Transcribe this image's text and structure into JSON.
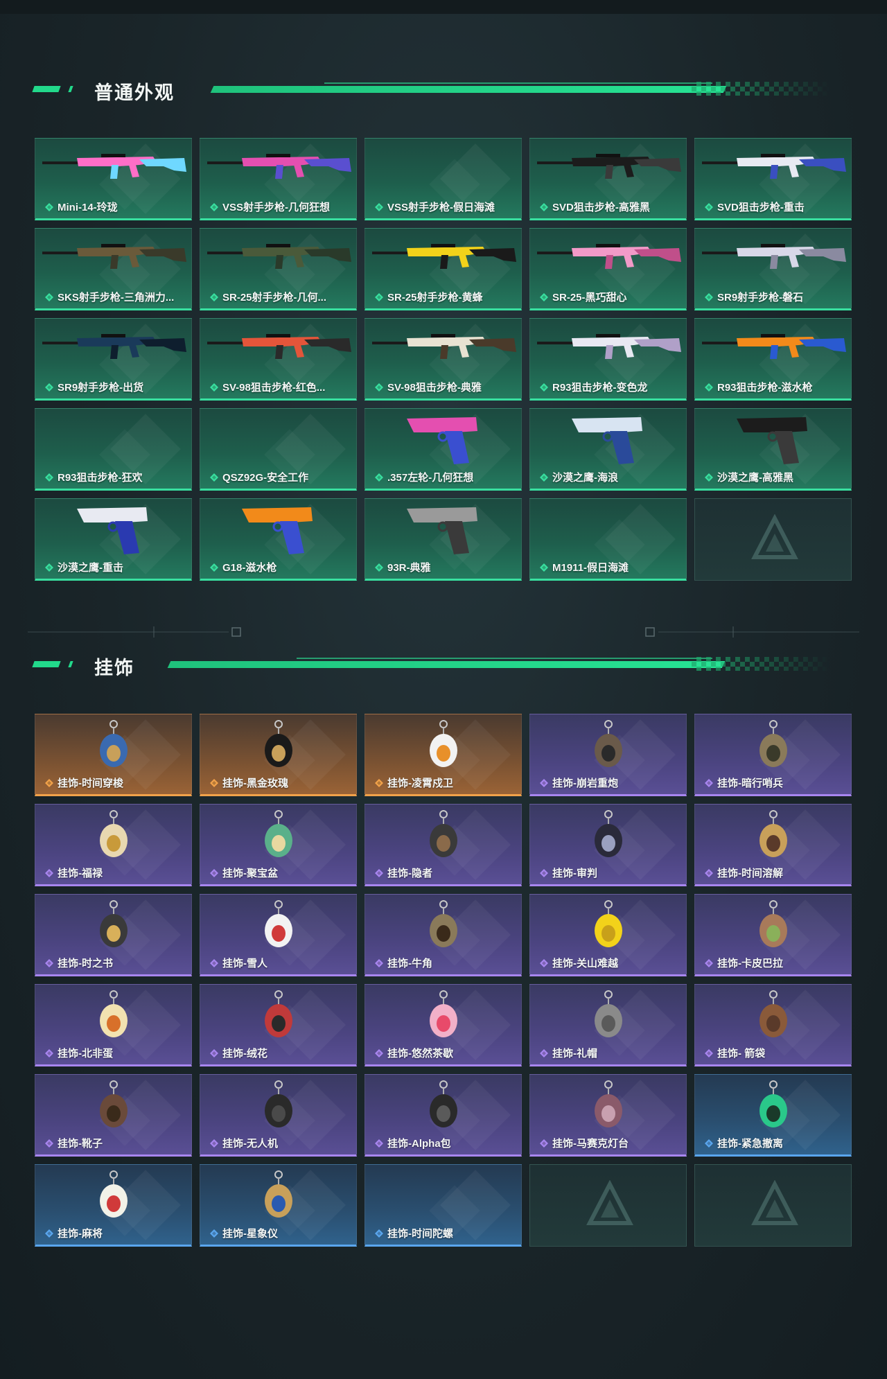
{
  "sections": [
    {
      "title": "普通外观",
      "theme_color": "#22d98b",
      "items": [
        {
          "label": "Mini-14-玲珑",
          "rarity": "green",
          "art": "rifle",
          "colors": [
            "#ff6ec7",
            "#6fd8ff"
          ]
        },
        {
          "label": "VSS射手步枪-几何狂想",
          "rarity": "green",
          "art": "rifle",
          "colors": [
            "#e44fb0",
            "#5a4fd0"
          ]
        },
        {
          "label": "VSS射手步枪-假日海滩",
          "rarity": "green",
          "art": "none",
          "colors": []
        },
        {
          "label": "SVD狙击步枪-高雅黑",
          "rarity": "green",
          "art": "rifle",
          "colors": [
            "#1c1c1c",
            "#3a3a3a"
          ]
        },
        {
          "label": "SVD狙击步枪-重击",
          "rarity": "green",
          "art": "rifle",
          "colors": [
            "#e8eaf2",
            "#3a4fc0"
          ]
        },
        {
          "label": "SKS射手步枪-三角洲力...",
          "rarity": "green",
          "art": "rifle",
          "colors": [
            "#6a5a3a",
            "#3a3a2a"
          ]
        },
        {
          "label": "SR-25射手步枪-几何...",
          "rarity": "green",
          "art": "rifle",
          "colors": [
            "#4a5a3a",
            "#2a3a2a"
          ]
        },
        {
          "label": "SR-25射手步枪-黄蜂",
          "rarity": "green",
          "art": "rifle",
          "colors": [
            "#f2d21a",
            "#1a1a1a"
          ]
        },
        {
          "label": "SR-25-黑巧甜心",
          "rarity": "green",
          "art": "rifle",
          "colors": [
            "#f29ac8",
            "#c04f8a"
          ]
        },
        {
          "label": "SR9射手步枪-磐石",
          "rarity": "green",
          "art": "rifle",
          "colors": [
            "#d8d8e8",
            "#8a8aa0"
          ]
        },
        {
          "label": "SR9射手步枪-出货",
          "rarity": "green",
          "art": "rifle",
          "colors": [
            "#1a3a5a",
            "#0e1e2e"
          ]
        },
        {
          "label": "SV-98狙击步枪-红色...",
          "rarity": "green",
          "art": "rifle",
          "colors": [
            "#e4553a",
            "#2a2a2a"
          ]
        },
        {
          "label": "SV-98狙击步枪-典雅",
          "rarity": "green",
          "art": "rifle",
          "colors": [
            "#e8e2d2",
            "#4a3a2a"
          ]
        },
        {
          "label": "R93狙击步枪-变色龙",
          "rarity": "green",
          "art": "rifle",
          "colors": [
            "#e8e8f2",
            "#b0a0c8"
          ]
        },
        {
          "label": "R93狙击步枪-滋水枪",
          "rarity": "green",
          "art": "rifle",
          "colors": [
            "#f28a1a",
            "#2a5ad0"
          ]
        },
        {
          "label": "R93狙击步枪-狂欢",
          "rarity": "green",
          "art": "none",
          "colors": []
        },
        {
          "label": "QSZ92G-安全工作",
          "rarity": "green",
          "art": "none",
          "colors": []
        },
        {
          "label": ".357左轮-几何狂想",
          "rarity": "green",
          "art": "pistol",
          "colors": [
            "#e44fb0",
            "#3a4fd0"
          ]
        },
        {
          "label": "沙漠之鹰-海浪",
          "rarity": "green",
          "art": "pistol",
          "colors": [
            "#d8e4f2",
            "#2a4a9a"
          ]
        },
        {
          "label": "沙漠之鹰-高雅黑",
          "rarity": "green",
          "art": "pistol",
          "colors": [
            "#1c1c1c",
            "#3a3a3a"
          ]
        },
        {
          "label": "沙漠之鹰-重击",
          "rarity": "green",
          "art": "pistol",
          "colors": [
            "#e8eaf2",
            "#2a3ab0"
          ]
        },
        {
          "label": "G18-滋水枪",
          "rarity": "green",
          "art": "pistol",
          "colors": [
            "#f28a1a",
            "#3a4fd0"
          ]
        },
        {
          "label": "93R-典雅",
          "rarity": "green",
          "art": "pistol",
          "colors": [
            "#9a9a9a",
            "#3a3a3a"
          ]
        },
        {
          "label": "M1911-假日海滩",
          "rarity": "green",
          "art": "none",
          "colors": []
        },
        {
          "label": "",
          "rarity": "empty",
          "art": "none",
          "colors": []
        }
      ]
    },
    {
      "title": "挂饰",
      "theme_color": "#22d98b",
      "items": [
        {
          "label": "挂饰-时间穿梭",
          "rarity": "orange",
          "art": "charm",
          "colors": [
            "#3a6ab0",
            "#c8a05a"
          ]
        },
        {
          "label": "挂饰-黑金玫瑰",
          "rarity": "orange",
          "art": "charm",
          "colors": [
            "#1a1a1a",
            "#c8a05a"
          ]
        },
        {
          "label": "挂饰-凌霄戍卫",
          "rarity": "orange",
          "art": "charm",
          "colors": [
            "#f2f2f2",
            "#e8902a"
          ]
        },
        {
          "label": "挂饰-崩岩重炮",
          "rarity": "purple",
          "art": "charm",
          "colors": [
            "#6a5a4a",
            "#2a2a2a"
          ]
        },
        {
          "label": "挂饰-暗行哨兵",
          "rarity": "purple",
          "art": "charm",
          "colors": [
            "#8a7a5a",
            "#3a3a2a"
          ]
        },
        {
          "label": "挂饰-福禄",
          "rarity": "purple",
          "art": "charm",
          "colors": [
            "#e8d8b0",
            "#c89a3a"
          ]
        },
        {
          "label": "挂饰-聚宝盆",
          "rarity": "purple",
          "art": "charm",
          "colors": [
            "#5ab08a",
            "#e8d8a0"
          ]
        },
        {
          "label": "挂饰-隐者",
          "rarity": "purple",
          "art": "charm",
          "colors": [
            "#3a3a3a",
            "#8a6a4a"
          ]
        },
        {
          "label": "挂饰-审判",
          "rarity": "purple",
          "art": "charm",
          "colors": [
            "#2a2a3a",
            "#9aa0c0"
          ]
        },
        {
          "label": "挂饰-时间溶解",
          "rarity": "purple",
          "art": "charm",
          "colors": [
            "#c8a05a",
            "#5a3a2a"
          ]
        },
        {
          "label": "挂饰-时之书",
          "rarity": "purple",
          "art": "charm",
          "colors": [
            "#3a3a3a",
            "#d8b05a"
          ]
        },
        {
          "label": "挂饰-雪人",
          "rarity": "purple",
          "art": "charm",
          "colors": [
            "#f2f2f2",
            "#d03a3a"
          ]
        },
        {
          "label": "挂饰-牛角",
          "rarity": "purple",
          "art": "charm",
          "colors": [
            "#8a7a5a",
            "#3a2a1a"
          ]
        },
        {
          "label": "挂饰-关山难越",
          "rarity": "purple",
          "art": "charm",
          "colors": [
            "#f2d21a",
            "#c8a01a"
          ]
        },
        {
          "label": "挂饰-卡皮巴拉",
          "rarity": "purple",
          "art": "charm",
          "colors": [
            "#a87a5a",
            "#8ab05a"
          ]
        },
        {
          "label": "挂饰-北非蛋",
          "rarity": "purple",
          "art": "charm",
          "colors": [
            "#f2e2b0",
            "#d8702a"
          ]
        },
        {
          "label": "挂饰-绒花",
          "rarity": "purple",
          "art": "charm",
          "colors": [
            "#c03a3a",
            "#2a2a2a"
          ]
        },
        {
          "label": "挂饰-悠然茶歇",
          "rarity": "purple",
          "art": "charm",
          "colors": [
            "#f2b0c8",
            "#e84a6a"
          ]
        },
        {
          "label": "挂饰-礼帽",
          "rarity": "purple",
          "art": "charm",
          "colors": [
            "#8a8a8a",
            "#5a5a5a"
          ]
        },
        {
          "label": "挂饰- 箭袋",
          "rarity": "purple",
          "art": "charm",
          "colors": [
            "#8a5a3a",
            "#5a3a2a"
          ]
        },
        {
          "label": "挂饰-靴子",
          "rarity": "purple",
          "art": "charm",
          "colors": [
            "#6a4a3a",
            "#3a2a1a"
          ]
        },
        {
          "label": "挂饰-无人机",
          "rarity": "purple",
          "art": "charm",
          "colors": [
            "#2a2a2a",
            "#4a4a4a"
          ]
        },
        {
          "label": "挂饰-Alpha包",
          "rarity": "purple",
          "art": "charm",
          "colors": [
            "#2a2a2a",
            "#5a5a5a"
          ]
        },
        {
          "label": "挂饰-马赛克灯台",
          "rarity": "purple",
          "art": "charm",
          "colors": [
            "#8a5a6a",
            "#c8a0b0"
          ]
        },
        {
          "label": "挂饰-紧急撤离",
          "rarity": "blue",
          "art": "charm",
          "colors": [
            "#2ac88a",
            "#1a3a2a"
          ]
        },
        {
          "label": "挂饰-麻将",
          "rarity": "blue",
          "art": "charm",
          "colors": [
            "#f2f2e8",
            "#d03a3a"
          ]
        },
        {
          "label": "挂饰-星象仪",
          "rarity": "blue",
          "art": "charm",
          "colors": [
            "#c8a05a",
            "#2a5ab0"
          ]
        },
        {
          "label": "挂饰-时间陀螺",
          "rarity": "blue",
          "art": "none",
          "colors": []
        },
        {
          "label": "",
          "rarity": "empty",
          "art": "none",
          "colors": []
        },
        {
          "label": "",
          "rarity": "empty",
          "art": "none",
          "colors": []
        }
      ]
    }
  ],
  "rarity_colors": {
    "green": "#39e0a0",
    "orange": "#f2a24a",
    "purple": "#a886f0",
    "blue": "#5aa6ee"
  },
  "icons": {
    "rarity_mark": "diamond-icon",
    "empty_slot": "delta-logo-icon"
  }
}
